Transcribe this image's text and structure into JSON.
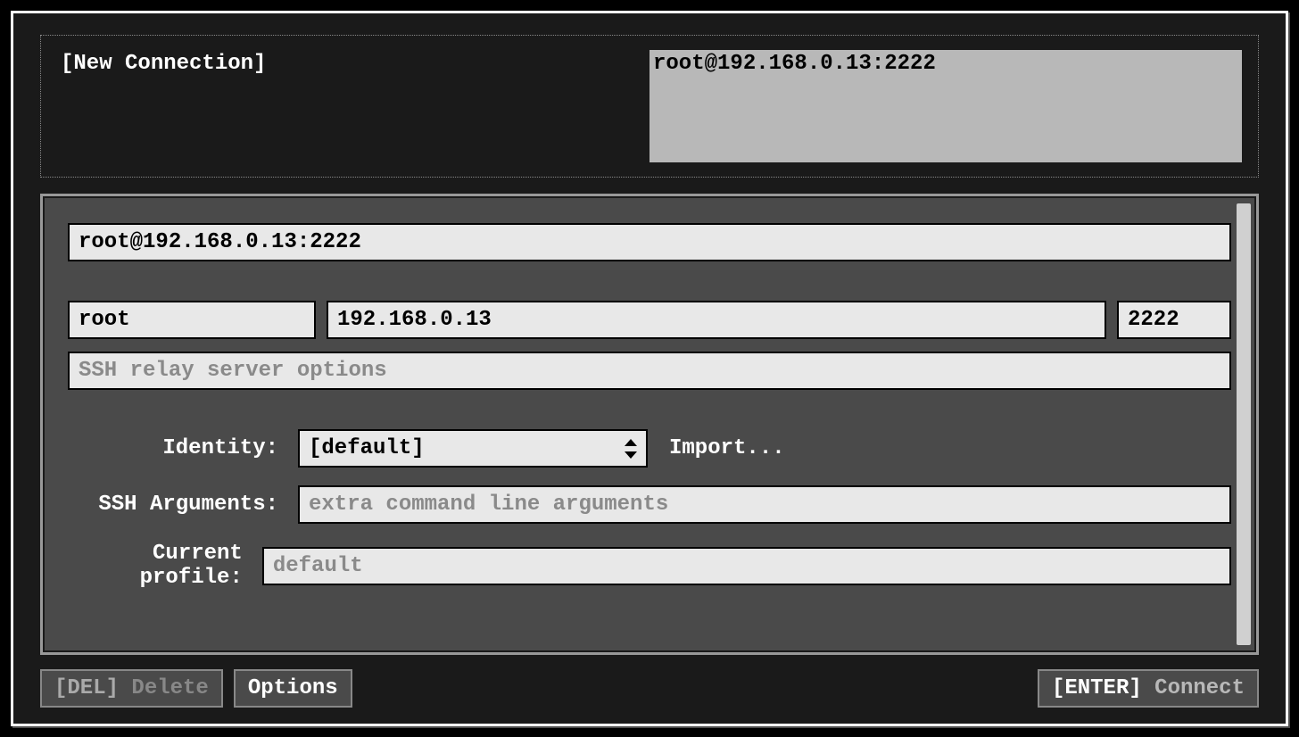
{
  "connections": {
    "new_label": "[New Connection]",
    "selected_label": "root@192.168.0.13:2222"
  },
  "form": {
    "connection_string": "root@192.168.0.13:2222",
    "user": "root",
    "host": "192.168.0.13",
    "port": "2222",
    "relay_placeholder": "SSH relay server options",
    "identity_label": "Identity:",
    "identity_value": "[default]",
    "import_label": "Import...",
    "ssh_args_label": "SSH Arguments:",
    "ssh_args_placeholder": "extra command line arguments",
    "profile_label": "Current profile:",
    "profile_value": "default"
  },
  "buttons": {
    "delete_key": "[DEL]",
    "delete_label": "Delete",
    "options_label": "Options",
    "connect_key": "[ENTER]",
    "connect_label": "Connect"
  }
}
